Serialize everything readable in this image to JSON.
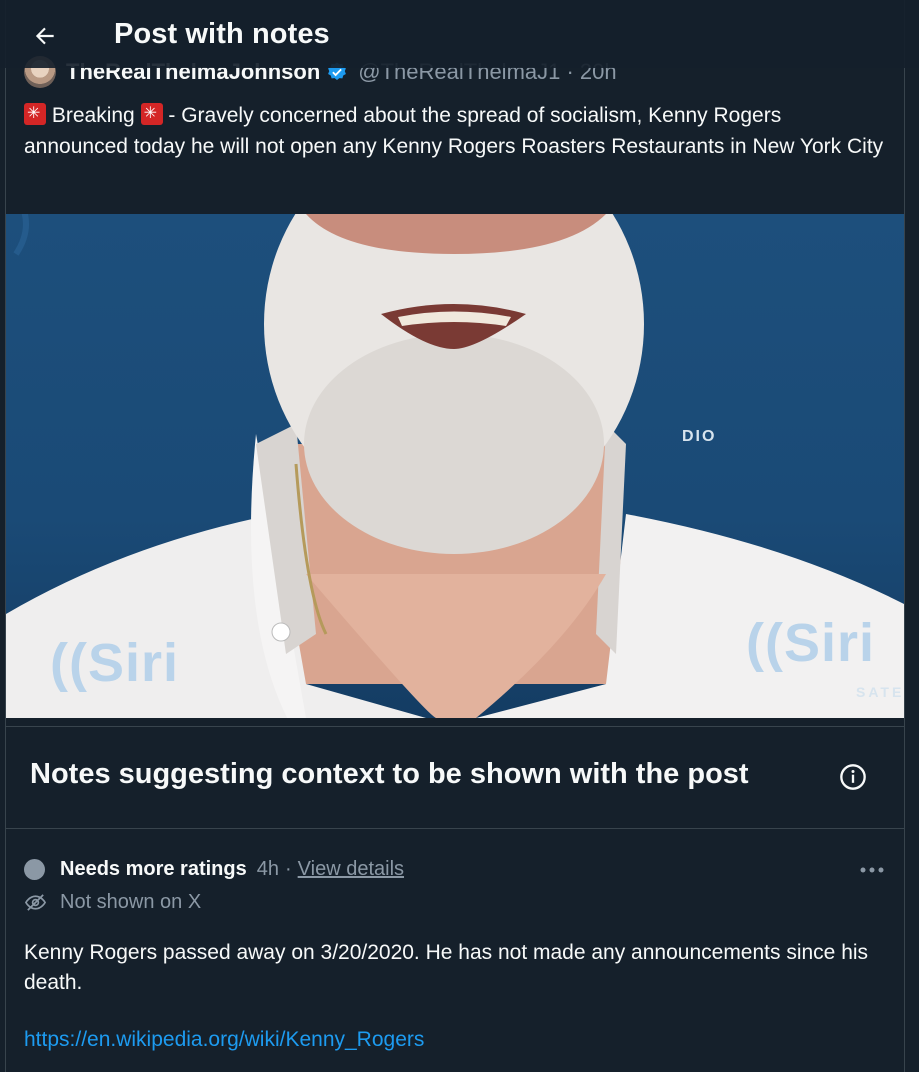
{
  "header": {
    "title": "Post with notes",
    "back_icon": "arrow-left-icon"
  },
  "post": {
    "author_name": "TheRealThelmaJohnson",
    "author_handle": "@TheRealThelmaJ1 · 20h",
    "text": " Breaking  - Gravely concerned about the spread of socialism, Kenny Rogers announced today he will not open any Kenny Rogers Roasters Restaurants in New York City",
    "text_parts": {
      "before": " Breaking ",
      "after": " - Gravely concerned about the spread of socialism, Kenny Rogers announced today he will not open any Kenny Rogers Roasters Restaurants in New York City"
    },
    "media": {
      "sirius_left": "((Siri",
      "sirius_right": "((Siri",
      "dio_text": "DIO",
      "sate_text": "SATE"
    }
  },
  "notes_section": {
    "title": "Notes suggesting context to be shown with the post",
    "info_icon": "info-icon"
  },
  "note": {
    "status": "Needs more ratings",
    "time": "4h",
    "separator": "·",
    "view_details": "View details",
    "visibility": "Not shown on X",
    "body": "Kenny Rogers passed away on 3/20/2020. He has not made any announcements since his death.",
    "link": "https://en.wikipedia.org/wiki/Kenny_Rogers"
  },
  "colors": {
    "background": "#15202b",
    "text": "#f7f9f9",
    "muted": "#8b98a5",
    "link": "#1d9bf0",
    "verified": "#1d9bf0"
  }
}
